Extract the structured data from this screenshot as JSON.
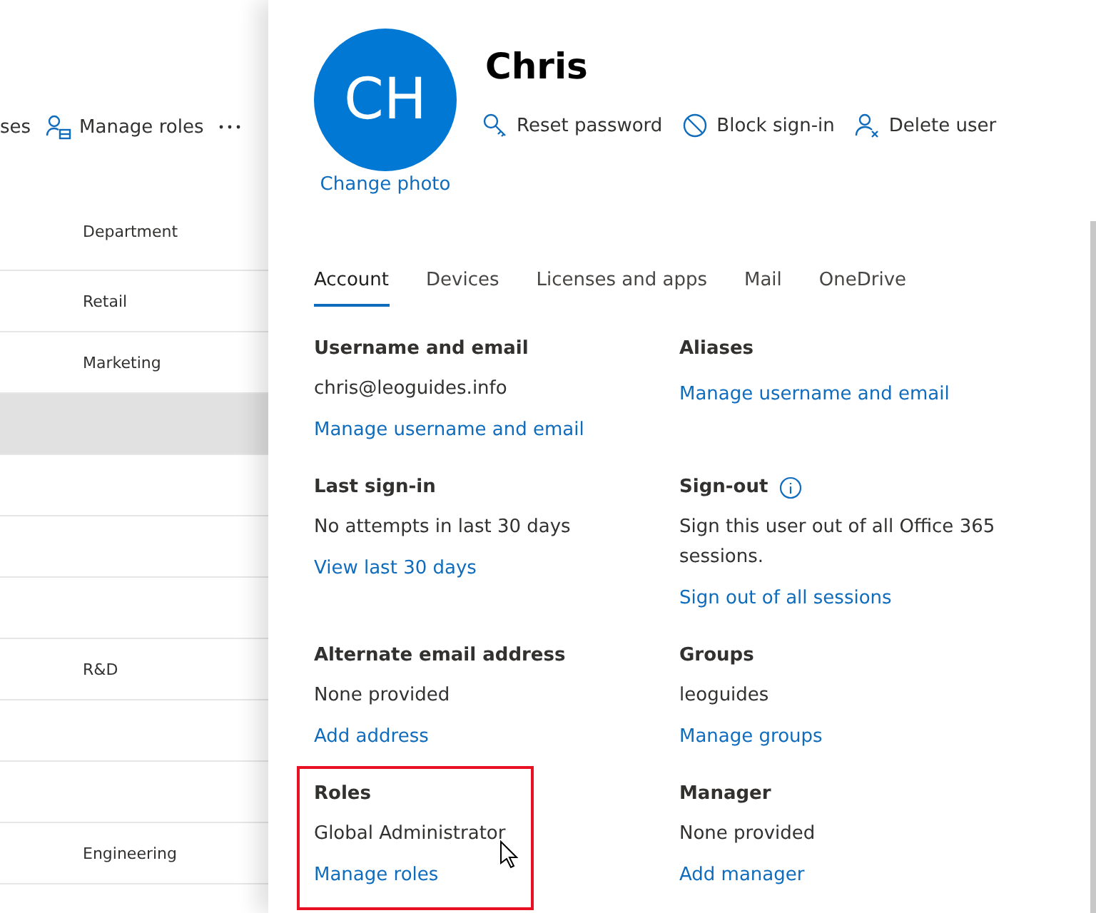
{
  "background_list": {
    "toolbar": [
      {
        "label": "ses",
        "kind": "text"
      },
      {
        "label": "Manage roles",
        "kind": "roles"
      },
      {
        "kind": "more"
      }
    ],
    "column_header": "Department",
    "rows": [
      {
        "department": "Retail",
        "selected": false
      },
      {
        "department": "Marketing",
        "selected": false
      },
      {
        "selected": true
      },
      {
        "selected": false
      },
      {
        "selected": false
      },
      {
        "selected": false
      },
      {
        "department": "R&D",
        "selected": false
      },
      {
        "selected": false
      },
      {
        "selected": false
      },
      {
        "department": "Engineering",
        "selected": false
      }
    ]
  },
  "user_panel": {
    "avatar_initials": "CH",
    "change_photo": "Change photo",
    "name": "Chris",
    "actions": [
      {
        "label": "Reset password",
        "kind": "key"
      },
      {
        "label": "Block sign-in",
        "kind": "block"
      },
      {
        "label": "Delete user",
        "kind": "delete-user"
      }
    ],
    "tabs": [
      {
        "label": "Account",
        "selected": true
      },
      {
        "label": "Devices",
        "selected": false
      },
      {
        "label": "Licenses and apps",
        "selected": false
      },
      {
        "label": "Mail",
        "selected": false
      },
      {
        "label": "OneDrive",
        "selected": false
      }
    ],
    "sections": [
      {
        "title": "Username and email",
        "lines": [
          {
            "text": "chris@leoguides.info",
            "kind": "text"
          },
          {
            "text": "Manage username and email",
            "kind": "link"
          }
        ]
      },
      {
        "title": "Aliases",
        "lines": [
          {
            "text": "Manage username and email",
            "kind": "link"
          }
        ]
      },
      {
        "title": "Last sign-in",
        "lines": [
          {
            "text": "No attempts in last 30 days",
            "kind": "text"
          },
          {
            "text": "View last 30 days",
            "kind": "link"
          }
        ]
      },
      {
        "title": "Sign-out",
        "info": true,
        "lines": [
          {
            "text": "Sign this user out of all Office 365 sessions.",
            "kind": "text"
          },
          {
            "text": "Sign out of all sessions",
            "kind": "link"
          }
        ]
      },
      {
        "title": "Alternate email address",
        "lines": [
          {
            "text": "None provided",
            "kind": "text"
          },
          {
            "text": "Add address",
            "kind": "link"
          }
        ]
      },
      {
        "title": "Groups",
        "lines": [
          {
            "text": "leoguides",
            "kind": "text"
          },
          {
            "text": "Manage groups",
            "kind": "link"
          }
        ]
      },
      {
        "title": "Roles",
        "highlighted": true,
        "lines": [
          {
            "text": "Global Administrator",
            "kind": "text"
          },
          {
            "text": "Manage roles",
            "kind": "link"
          }
        ]
      },
      {
        "title": "Manager",
        "lines": [
          {
            "text": "None provided",
            "kind": "text"
          },
          {
            "text": "Add manager",
            "kind": "link"
          }
        ]
      }
    ]
  }
}
